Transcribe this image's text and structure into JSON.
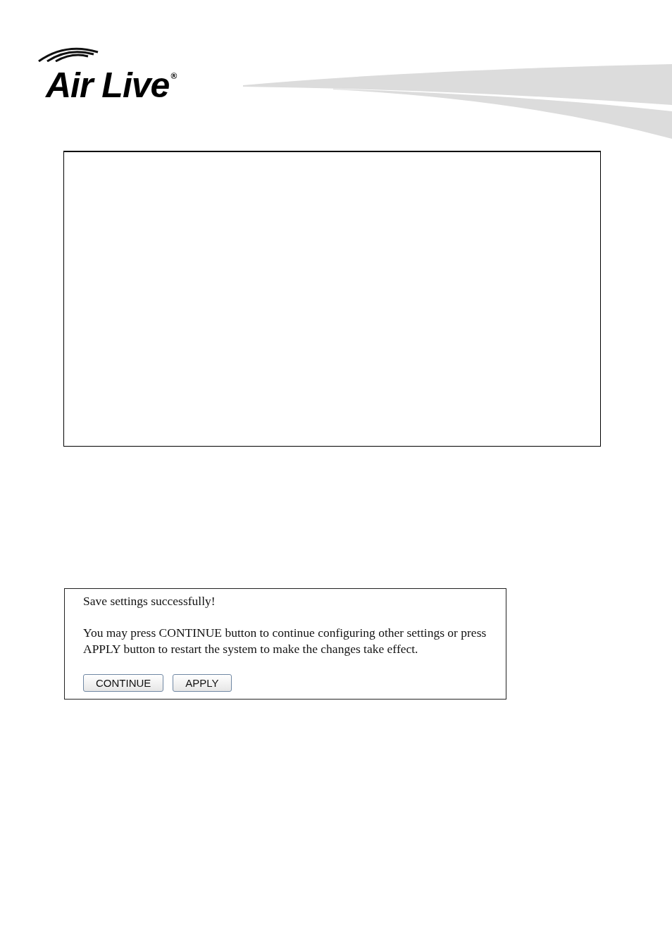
{
  "header": {
    "logo": "Air Live$^{®}$"
  },
  "dialog": {
    "message": "Save settings successfully!",
    "instructions": "You may press CONTINUE button to continue configuring other settings or press APPLY button to restart the system to make the changes take effect.",
    "buttons": [
      "CONTINUE",
      "APPLY"
    ]
  }
}
